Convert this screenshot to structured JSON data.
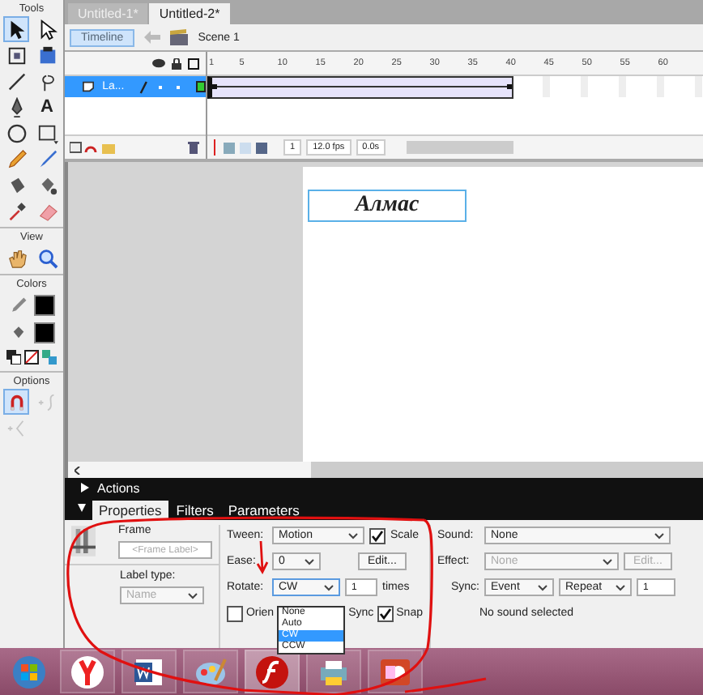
{
  "tools_panel": {
    "title": "Tools",
    "tools": [
      {
        "kind": "arrow",
        "selected": true
      },
      {
        "kind": "subselect",
        "selected": false
      },
      {
        "kind": "transform",
        "selected": false
      },
      {
        "kind": "gradient",
        "selected": false
      },
      {
        "kind": "line",
        "selected": false
      },
      {
        "kind": "lasso",
        "selected": false
      },
      {
        "kind": "pen",
        "selected": false
      },
      {
        "kind": "text",
        "glyph": "A",
        "selected": false
      },
      {
        "kind": "oval",
        "selected": false
      },
      {
        "kind": "rect",
        "selected": false
      },
      {
        "kind": "pencil",
        "selected": false
      },
      {
        "kind": "brush",
        "selected": false
      },
      {
        "kind": "inkbottle",
        "selected": false
      },
      {
        "kind": "bucket",
        "selected": false
      },
      {
        "kind": "eyedropper",
        "selected": false
      },
      {
        "kind": "eraser",
        "selected": false
      }
    ]
  },
  "view": {
    "title": "View",
    "tools": [
      {
        "kind": "hand",
        "selected": false
      },
      {
        "kind": "zoom",
        "selected": false
      }
    ]
  },
  "colors": {
    "title": "Colors",
    "stroke": {
      "color": "#000000"
    },
    "fill": {
      "color": "#000000"
    }
  },
  "options": {
    "title": "Options",
    "tools": [
      {
        "kind": "magnet",
        "selected": true,
        "disabled": false
      },
      {
        "kind": "smooth",
        "selected": false,
        "disabled": true
      },
      {
        "kind": "straighten",
        "selected": false,
        "disabled": true
      }
    ]
  },
  "document_tabs": [
    {
      "label": "Untitled-1*",
      "selected": false
    },
    {
      "label": "Untitled-2*",
      "selected": true
    }
  ],
  "timeline": {
    "button": "Timeline",
    "scene": "Scene 1",
    "ruler": [
      "1",
      "5",
      "10",
      "15",
      "20",
      "25",
      "30",
      "35",
      "40",
      "45",
      "50",
      "55",
      "60"
    ],
    "layers": [
      {
        "name": "La...",
        "selected": true,
        "color": "#33cc33"
      }
    ],
    "frame": "1",
    "fps": "12.0 fps",
    "time": "0.0s"
  },
  "stage": {
    "text": "Алмас"
  },
  "actions_panel": {
    "title": "Actions",
    "expanded": false
  },
  "properties": {
    "tabs": [
      {
        "label": "Properties",
        "selected": true
      },
      {
        "label": "Filters",
        "selected": false
      },
      {
        "label": "Parameters",
        "selected": false
      }
    ],
    "frame_label": "Frame",
    "frame_placeholder": "<Frame Label>",
    "label_type_label": "Label type:",
    "label_type": "Name",
    "tween_label": "Tween:",
    "tween": "Motion",
    "scale": {
      "label": "Scale",
      "checked": true
    },
    "ease_label": "Ease:",
    "ease": "0",
    "edit": "Edit...",
    "rotate_label": "Rotate:",
    "rotate": "CW",
    "times_value": "1",
    "times_label": "times",
    "rotate_options": [
      {
        "label": "None",
        "selected": false
      },
      {
        "label": "Auto",
        "selected": false
      },
      {
        "label": "CW",
        "selected": true
      },
      {
        "label": "CCW",
        "selected": false
      }
    ],
    "orient": {
      "label": "Orien",
      "checked": false
    },
    "sync_check": {
      "label": "Sync"
    },
    "snap": {
      "label": "Snap",
      "checked": true
    },
    "sound_label": "Sound:",
    "sound": "None",
    "effect_label": "Effect:",
    "effect": "None",
    "effect_edit": "Edit...",
    "sync_label": "Sync:",
    "sync": "Event",
    "repeat": "Repeat",
    "repeat_count": "1",
    "sound_status": "No sound selected"
  },
  "taskbar": {
    "apps": [
      {
        "kind": "start"
      },
      {
        "kind": "yandex"
      },
      {
        "kind": "word"
      },
      {
        "kind": "paint"
      },
      {
        "kind": "flash",
        "selected": true
      },
      {
        "kind": "printer"
      },
      {
        "kind": "powerpoint"
      }
    ]
  }
}
